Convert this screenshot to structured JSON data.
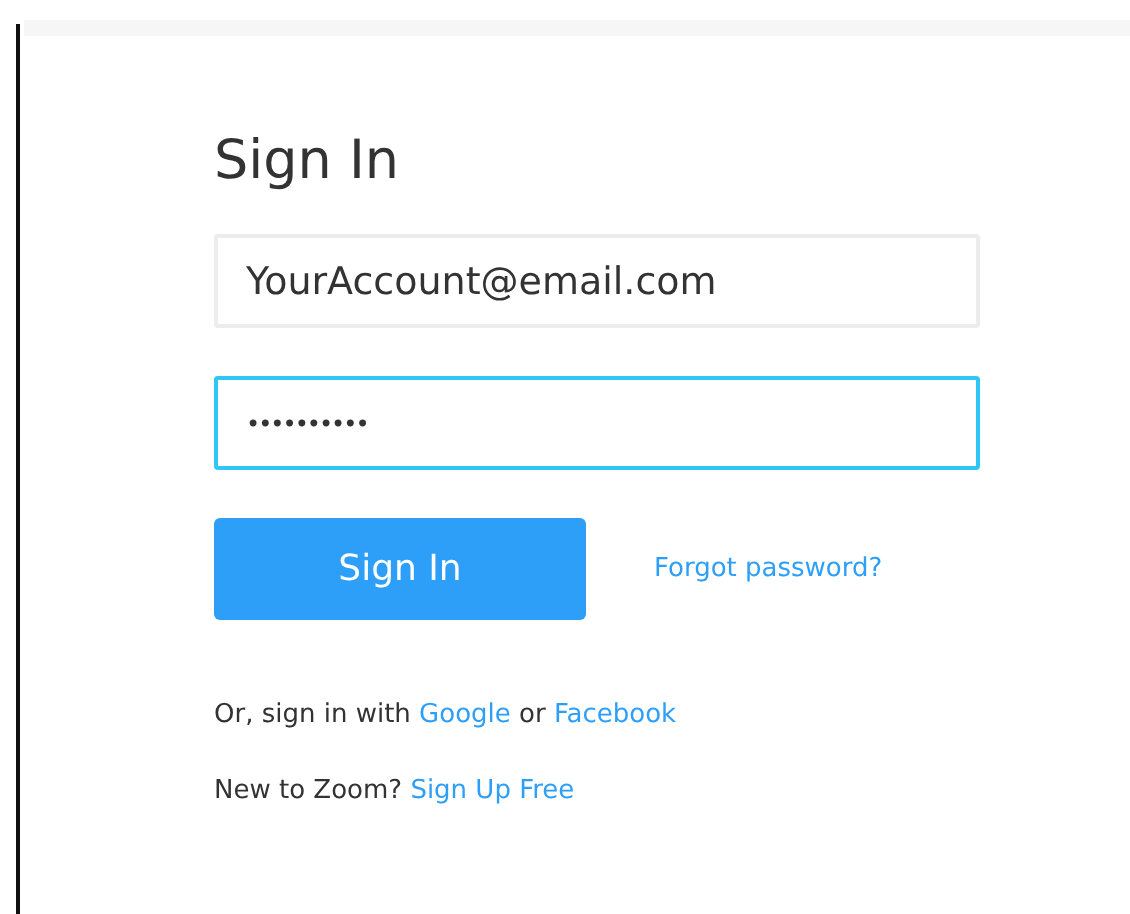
{
  "title": "Sign In",
  "fields": [
    {
      "kind": "email",
      "value": "YourAccount@email.com",
      "focused": false
    },
    {
      "kind": "password",
      "value": "••••••••••",
      "focused": true
    }
  ],
  "submit_button": "Sign In",
  "forgot_link": "Forgot password?",
  "social_line": [
    {
      "kind": "text",
      "text": "Or, sign in with "
    },
    {
      "kind": "link",
      "text": "Google"
    },
    {
      "kind": "text",
      "text": " or "
    },
    {
      "kind": "link",
      "text": "Facebook"
    }
  ],
  "signup_line": [
    {
      "kind": "text",
      "text": "New to Zoom? "
    },
    {
      "kind": "link",
      "text": "Sign Up Free"
    }
  ]
}
